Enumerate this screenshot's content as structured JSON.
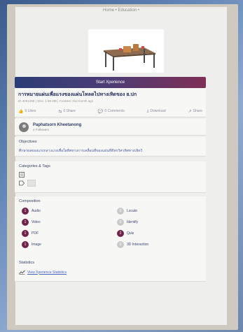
{
  "nav": {
    "text": "Home • Education •"
  },
  "start_button": "Start Xperience",
  "title": {
    "text": "การหมายแผ่นเพื่อแรงของแผ่นโหลดไปทางเทิดของ ย.ปก",
    "subtitle": "ID 4051295 | Size: 1.56 MB | Created: 2nd month ago"
  },
  "actions": [
    {
      "icon": "thumbs-up-icon",
      "glyph": "👍",
      "label": "0 Likes"
    },
    {
      "icon": "share-icon",
      "glyph": "⇆",
      "label": "0 Share"
    },
    {
      "icon": "comment-icon",
      "glyph": "💬",
      "label": "0 Comments"
    },
    {
      "icon": "download-icon",
      "glyph": "⤓",
      "label": "Download"
    },
    {
      "icon": "share-alt-icon",
      "glyph": "↗",
      "label": "Share"
    }
  ],
  "author": {
    "name": "Paphatsorn Kheetanong",
    "followers": "4 Followers"
  },
  "objectives": {
    "title": "Objectives",
    "text": "ศึกษาผลของแรงกลางแรงเพื่อใดทิศทางการเคลื่อนที่ของแผ่นที่ดีหกวิศวทิศทางเทิดวิ"
  },
  "categories": {
    "title": "Categories & Tags"
  },
  "composition": {
    "title": "Composition",
    "items": [
      {
        "count": "1",
        "label": "Audio",
        "filled": true
      },
      {
        "count": "0",
        "label": "Locate",
        "filled": false
      },
      {
        "count": "1",
        "label": "Video",
        "filled": true
      },
      {
        "count": "0",
        "label": "Identify",
        "filled": false
      },
      {
        "count": "1",
        "label": "PDF",
        "filled": true
      },
      {
        "count": "2",
        "label": "Quiz",
        "filled": true
      },
      {
        "count": "1",
        "label": "Image",
        "filled": true
      },
      {
        "count": "0",
        "label": "3D Interaction",
        "filled": false
      }
    ]
  },
  "statistics": {
    "title": "Statistics",
    "link": "View Xperience Statistics"
  },
  "colors": {
    "accent_maroon": "#6e2448",
    "accent_navy": "#2c3d77",
    "link_blue": "#4a66c4"
  }
}
